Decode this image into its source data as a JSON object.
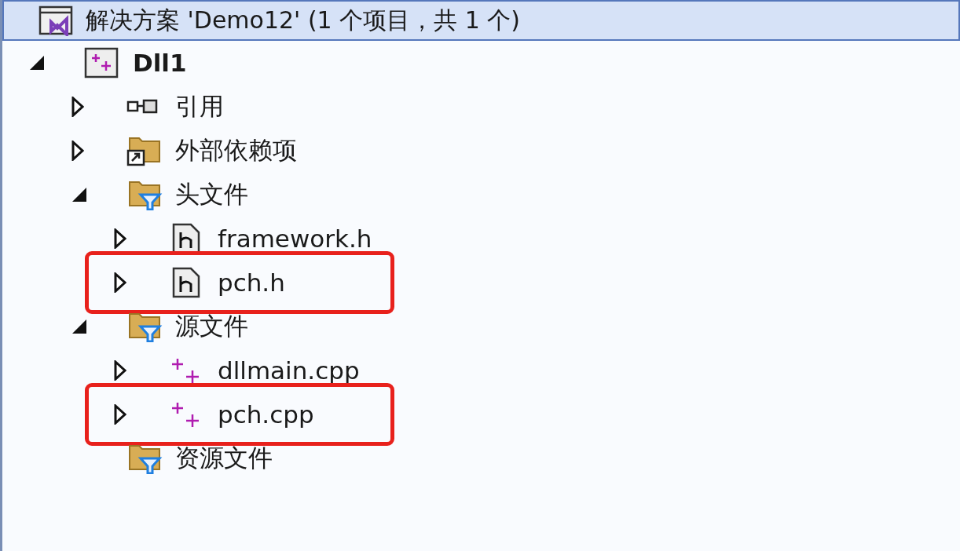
{
  "solution": {
    "label": "解决方案 'Demo12' (1 个项目，共 1 个)",
    "selected": true
  },
  "tree": [
    {
      "label": "Dll1",
      "kind": "project",
      "expandable": true,
      "expanded": true,
      "highlighted": false,
      "children": [
        {
          "label": "引用",
          "kind": "references",
          "expandable": true,
          "expanded": false,
          "highlighted": false
        },
        {
          "label": "外部依赖项",
          "kind": "external",
          "expandable": true,
          "expanded": false,
          "highlighted": false
        },
        {
          "label": "头文件",
          "kind": "filter",
          "expandable": true,
          "expanded": true,
          "highlighted": false,
          "children": [
            {
              "label": "framework.h",
              "kind": "header",
              "expandable": true,
              "expanded": false,
              "highlighted": false
            },
            {
              "label": "pch.h",
              "kind": "header",
              "expandable": true,
              "expanded": false,
              "highlighted": true
            }
          ]
        },
        {
          "label": "源文件",
          "kind": "filter",
          "expandable": true,
          "expanded": true,
          "highlighted": false,
          "children": [
            {
              "label": "dllmain.cpp",
              "kind": "cpp",
              "expandable": true,
              "expanded": false,
              "highlighted": false
            },
            {
              "label": "pch.cpp",
              "kind": "cpp",
              "expandable": true,
              "expanded": false,
              "highlighted": true
            }
          ]
        },
        {
          "label": "资源文件",
          "kind": "filter",
          "expandable": false,
          "highlighted": false
        }
      ]
    }
  ]
}
